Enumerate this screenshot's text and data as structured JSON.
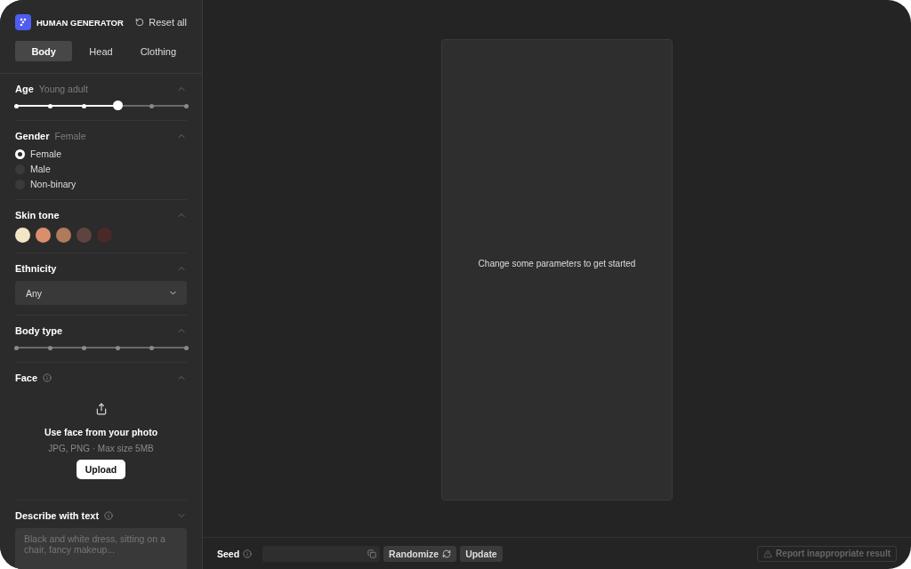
{
  "app": {
    "title": "HUMAN GENERATOR",
    "reset": "Reset all"
  },
  "tabs": [
    {
      "label": "Body",
      "selected": true
    },
    {
      "label": "Head",
      "selected": false
    },
    {
      "label": "Clothing",
      "selected": false
    }
  ],
  "age": {
    "title": "Age",
    "value": "Young adult",
    "level": 0.6,
    "expanded": true
  },
  "gender": {
    "title": "Gender",
    "value": "Female",
    "expanded": true,
    "options": [
      {
        "label": "Female",
        "selected": true
      },
      {
        "label": "Male",
        "selected": false
      },
      {
        "label": "Non-binary",
        "selected": false
      }
    ]
  },
  "skin_tone": {
    "title": "Skin tone",
    "expanded": true,
    "swatches": [
      {
        "color": "#f3e6c4"
      },
      {
        "color": "#d98f6e"
      },
      {
        "color": "#b07a5c"
      },
      {
        "color": "#5e4440"
      },
      {
        "color": "#4a2a28"
      }
    ]
  },
  "ethnicity": {
    "title": "Ethnicity",
    "expanded": true,
    "value": "Any"
  },
  "body_type": {
    "title": "Body type",
    "expanded": true
  },
  "face": {
    "title": "Face",
    "expanded": true,
    "heading": "Use face from your photo",
    "hint": "JPG, PNG · Max size 5MB",
    "button": "Upload"
  },
  "describe": {
    "title": "Describe with text",
    "expanded": false,
    "placeholder": "Black and white dress, sitting on a chair, fancy makeup..."
  },
  "preview": {
    "message": "Change some parameters to get started"
  },
  "bottom_bar": {
    "seed_label": "Seed",
    "randomize": "Randomize",
    "update": "Update",
    "report": "Report inappropriate result"
  }
}
